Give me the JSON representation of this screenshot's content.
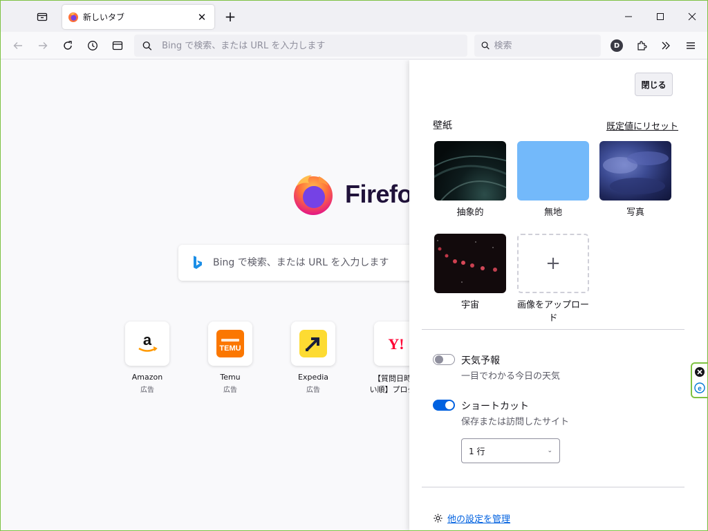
{
  "tab": {
    "title": "新しいタブ",
    "close": "✕"
  },
  "toolbar": {
    "new_tab": "+",
    "url_placeholder": "Bing で検索、または URL を入力します",
    "search_placeholder": "検索",
    "account_initial": "D"
  },
  "content": {
    "logo_text": "Firefox",
    "search_placeholder": "Bing で検索、または URL を入力します",
    "tiles": [
      {
        "name": "Amazon",
        "ad": "広告"
      },
      {
        "name": "Temu",
        "ad": "広告"
      },
      {
        "name": "Expedia",
        "ad": "広告"
      },
      {
        "name": "【質問日時の",
        "name2": "い順】プログラ"
      }
    ]
  },
  "panel": {
    "close_label": "閉じる",
    "wallpaper_title": "壁紙",
    "reset_label": "既定値にリセット",
    "wallpapers": [
      {
        "label": "抽象的"
      },
      {
        "label": "無地"
      },
      {
        "label": "写真"
      },
      {
        "label": "宇宙"
      },
      {
        "label": "画像をアップロード"
      }
    ],
    "weather": {
      "title": "天気予報",
      "desc": "一目でわかる今日の天気"
    },
    "shortcuts": {
      "title": "ショートカット",
      "desc": "保存または訪問したサイト",
      "rows_value": "1 行"
    },
    "manage_label": "他の設定を管理"
  },
  "colors": {
    "accent": "#0061e0",
    "window_border": "#7dc142",
    "solid_wallpaper": "#73b9fa"
  }
}
